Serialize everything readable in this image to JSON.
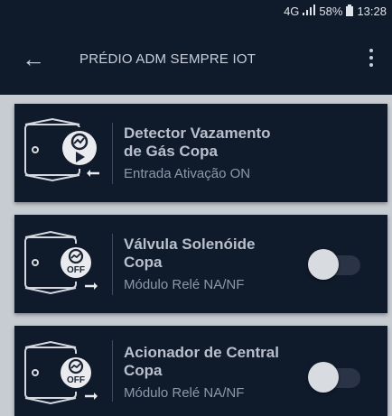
{
  "status_bar": {
    "network": "4G",
    "signal_icon": "signal-bars-icon",
    "battery": "58%",
    "time": "13:28"
  },
  "app_bar": {
    "title": "PRÉDIO ADM SEMPRE IOT",
    "back_icon": "arrow-left-icon",
    "menu_icon": "more-vertical-icon"
  },
  "devices": [
    {
      "title_line1": "Detector Vazamento",
      "title_line2": "de Gás Copa",
      "subtitle": "Entrada Ativação ON",
      "icon": "gas-detector-play-icon",
      "has_toggle": false
    },
    {
      "title_line1": "Válvula Solenóide",
      "title_line2": "Copa",
      "subtitle": "Módulo Relé NA/NF",
      "icon": "relay-off-icon",
      "icon_label": "OFF",
      "has_toggle": true,
      "toggle_on": false
    },
    {
      "title_line1": "Acionador de Central",
      "title_line2": "Copa",
      "subtitle": "Módulo Relé NA/NF",
      "icon": "relay-off-icon",
      "icon_label": "OFF",
      "has_toggle": true,
      "toggle_on": false
    }
  ]
}
